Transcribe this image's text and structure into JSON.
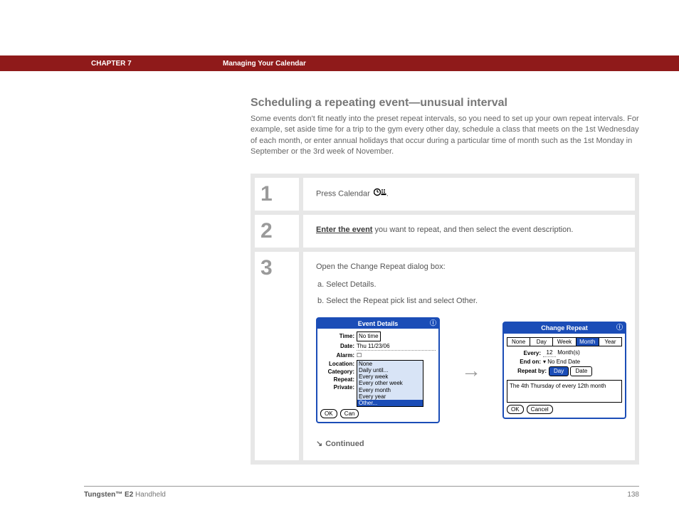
{
  "header": {
    "chapter": "CHAPTER 7",
    "title": "Managing Your Calendar"
  },
  "page": {
    "heading": "Scheduling a repeating event—unusual interval",
    "intro": "Some events don't fit neatly into the preset repeat intervals, so you need to set up your own repeat intervals. For example, set aside time for a trip to the gym every other day, schedule a class that meets on the 1st Wednesday of each month, or enter annual holidays that occur during a particular time of month such as the 1st Monday in September or the 3rd week of November."
  },
  "steps": {
    "s1": {
      "num": "1",
      "text": "Press Calendar "
    },
    "s2": {
      "num": "2",
      "link": "Enter the event",
      "rest": " you want to repeat, and then select the event description."
    },
    "s3": {
      "num": "3",
      "lead": "Open the Change Repeat dialog box:",
      "a": "a.  Select Details.",
      "b": "b.  Select the Repeat pick list and select Other."
    }
  },
  "palm1": {
    "title": "Event Details",
    "labels": {
      "time": "Time:",
      "date": "Date:",
      "alarm": "Alarm:",
      "location": "Location:",
      "category": "Category:",
      "repeat": "Repeat:",
      "private": "Private:"
    },
    "values": {
      "time": "No time",
      "date": "Thu 11/23/06"
    },
    "options": [
      "None",
      "Daily until...",
      "Every week",
      "Every other week",
      "Every month",
      "Every year",
      "Other..."
    ],
    "btns": {
      "ok": "OK",
      "cancel": "Can"
    }
  },
  "palm2": {
    "title": "Change Repeat",
    "tabs": [
      "None",
      "Day",
      "Week",
      "Month",
      "Year"
    ],
    "every_label": "Every:",
    "every_val": "12",
    "every_unit": "Month(s)",
    "end_label": "End on:",
    "end_val": "No End Date",
    "repeatby_label": "Repeat by:",
    "repeatby_opts": {
      "day": "Day",
      "date": "Date"
    },
    "desc": "The 4th Thursday of every 12th month",
    "btns": {
      "ok": "OK",
      "cancel": "Cancel"
    }
  },
  "continued": "Continued",
  "footer": {
    "brand": "Tungsten™ E2",
    "kind": " Handheld",
    "page": "138"
  }
}
